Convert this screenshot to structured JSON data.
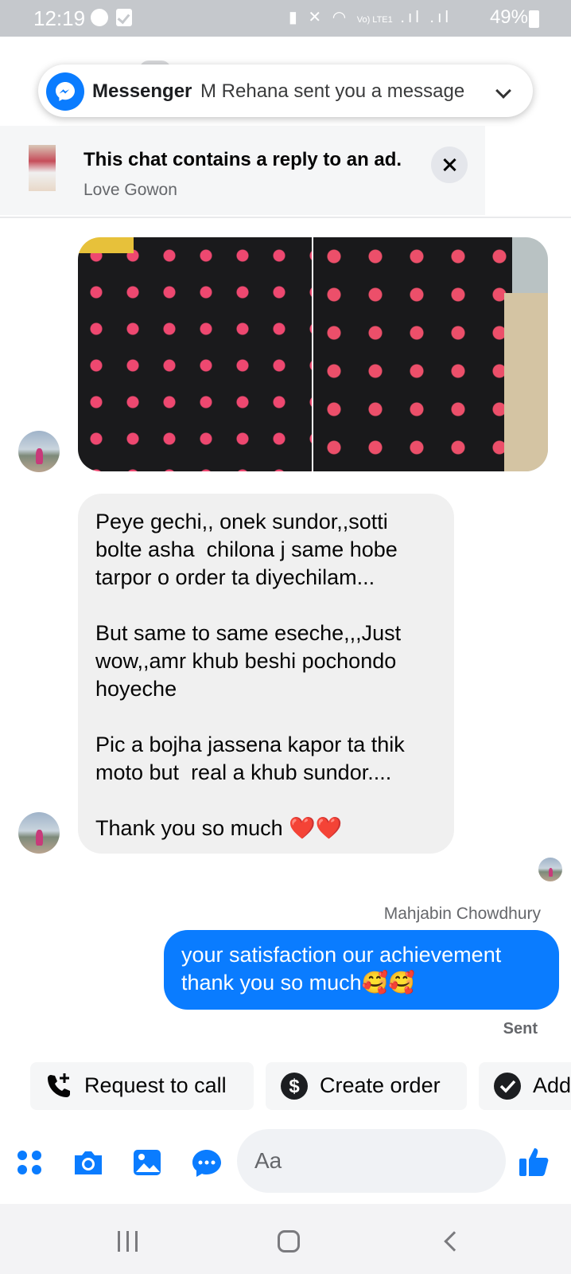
{
  "status_bar": {
    "time": "12:19",
    "battery": "49%",
    "network_label": "Vo) LTE1"
  },
  "notification": {
    "app_name": "Messenger",
    "message": "M Rehana sent you a message",
    "icon": "messenger-icon"
  },
  "ad_banner": {
    "title": "This chat contains a reply to an ad.",
    "subtitle": "Love Gowon"
  },
  "conversation": {
    "incoming_message": "Peye gechi,, onek sundor,,sotti bolte asha  chilona j same hobe tarpor o order ta diyechilam...\n\nBut same to same eseche,,,Just wow,,amr khub beshi pochondo hoyeche\n\nPic a bojha jassena kapor ta thik moto but  real a khub sundor....\n\nThank you so much ❤️❤️",
    "reply_sender": "Mahjabin Chowdhury",
    "outgoing_message": "your satisfaction our achievement thank you so much🥰🥰",
    "delivery_status": "Sent"
  },
  "quick_replies": [
    {
      "label": "Request to call",
      "icon": "phone-plus-icon"
    },
    {
      "label": "Create order",
      "icon": "dollar-icon"
    },
    {
      "label": "Add",
      "icon": "check-circle-icon"
    }
  ],
  "composer": {
    "placeholder": "Aa"
  },
  "colors": {
    "accent": "#0a7cff",
    "bubble_incoming": "#f0f0f0",
    "secondary_text": "#65676b"
  }
}
